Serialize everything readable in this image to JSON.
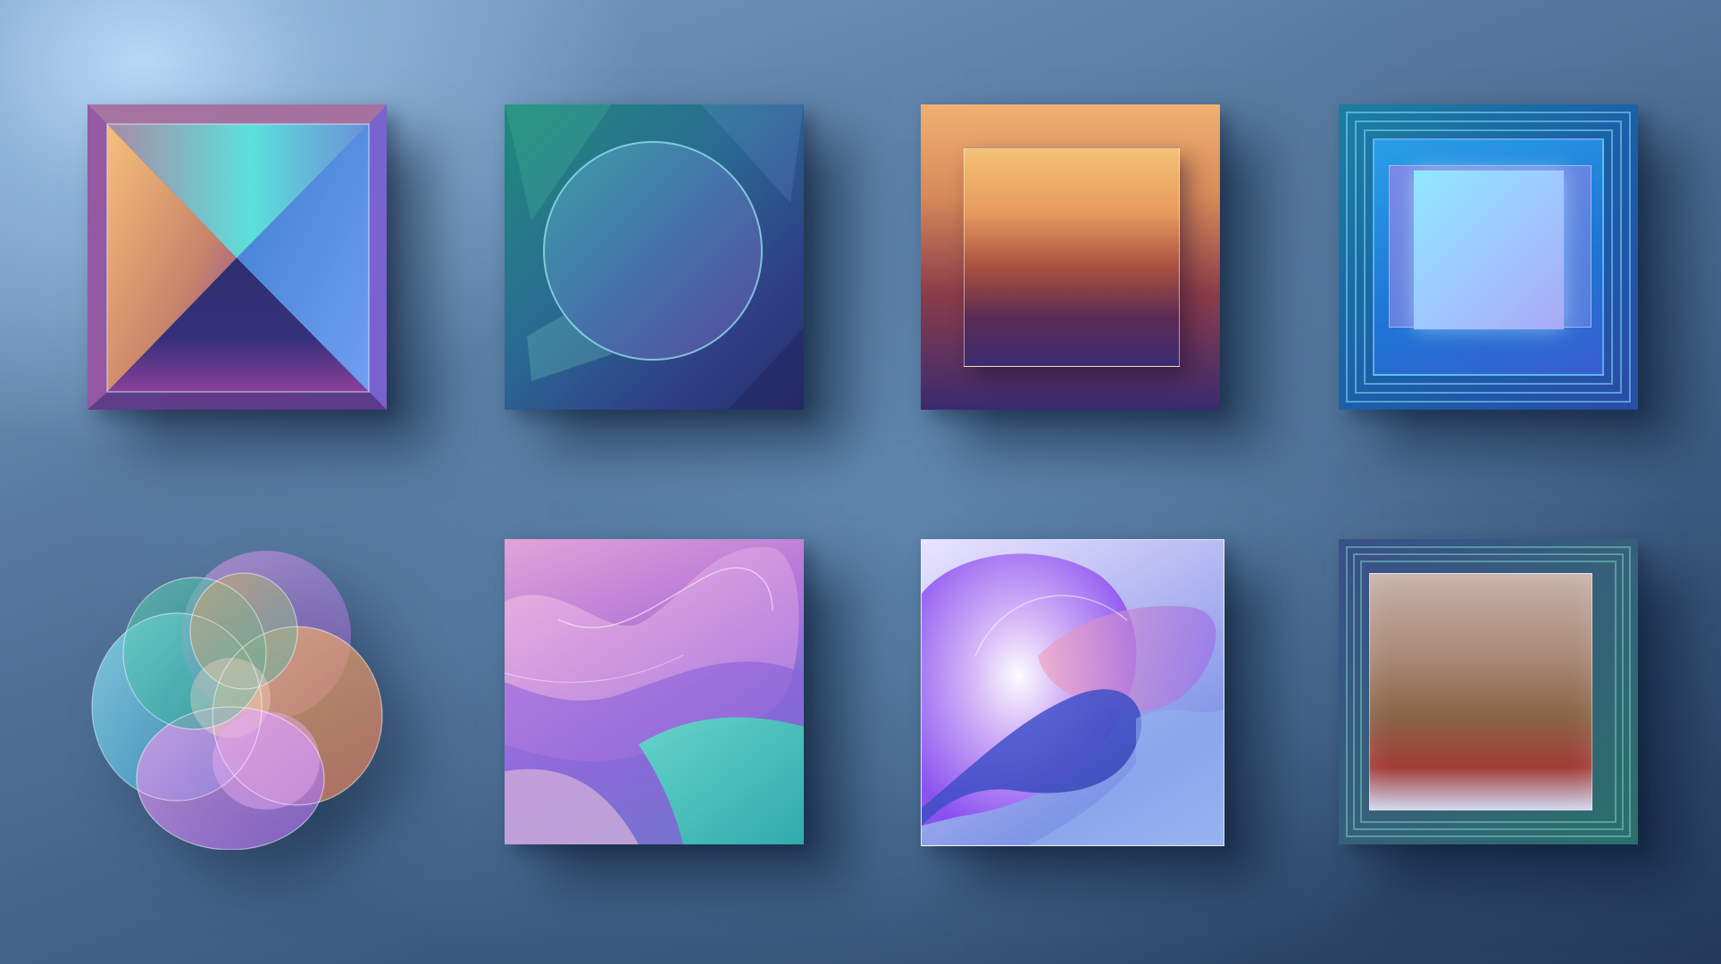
{
  "scene": {
    "background_colors": [
      "#b9d8f7",
      "#7fa4c9",
      "#3c5a7f",
      "#22395a"
    ],
    "tiles": [
      {
        "name": "pyramid-gradient-tile",
        "colors": [
          "#f0b070",
          "#50d8d8",
          "#5d6fd0",
          "#6a3f92"
        ]
      },
      {
        "name": "circle-glass-tile",
        "colors": [
          "#1f8a7a",
          "#2a6d93",
          "#2e3f86"
        ]
      },
      {
        "name": "warm-square-tile",
        "colors": [
          "#f4c277",
          "#a85040",
          "#3b2c72"
        ]
      },
      {
        "name": "blue-nested-frames-tile",
        "colors": [
          "#8fe8ff",
          "#1d74d4",
          "#3a5fd0"
        ]
      },
      {
        "name": "iridescent-flower-tile",
        "colors": [
          "#3fb0d8",
          "#f0a060",
          "#c890e8",
          "#58c8a8"
        ]
      },
      {
        "name": "purple-wave-tile",
        "colors": [
          "#e3a3d8",
          "#b677d8",
          "#3fcab8"
        ]
      },
      {
        "name": "lavender-blob-tile",
        "colors": [
          "#e9e4ff",
          "#8a4df0",
          "#3c54c8"
        ]
      },
      {
        "name": "warm-nested-frames-tile",
        "colors": [
          "#c8b1a8",
          "#a33c36",
          "#2b6f6c"
        ]
      }
    ]
  }
}
